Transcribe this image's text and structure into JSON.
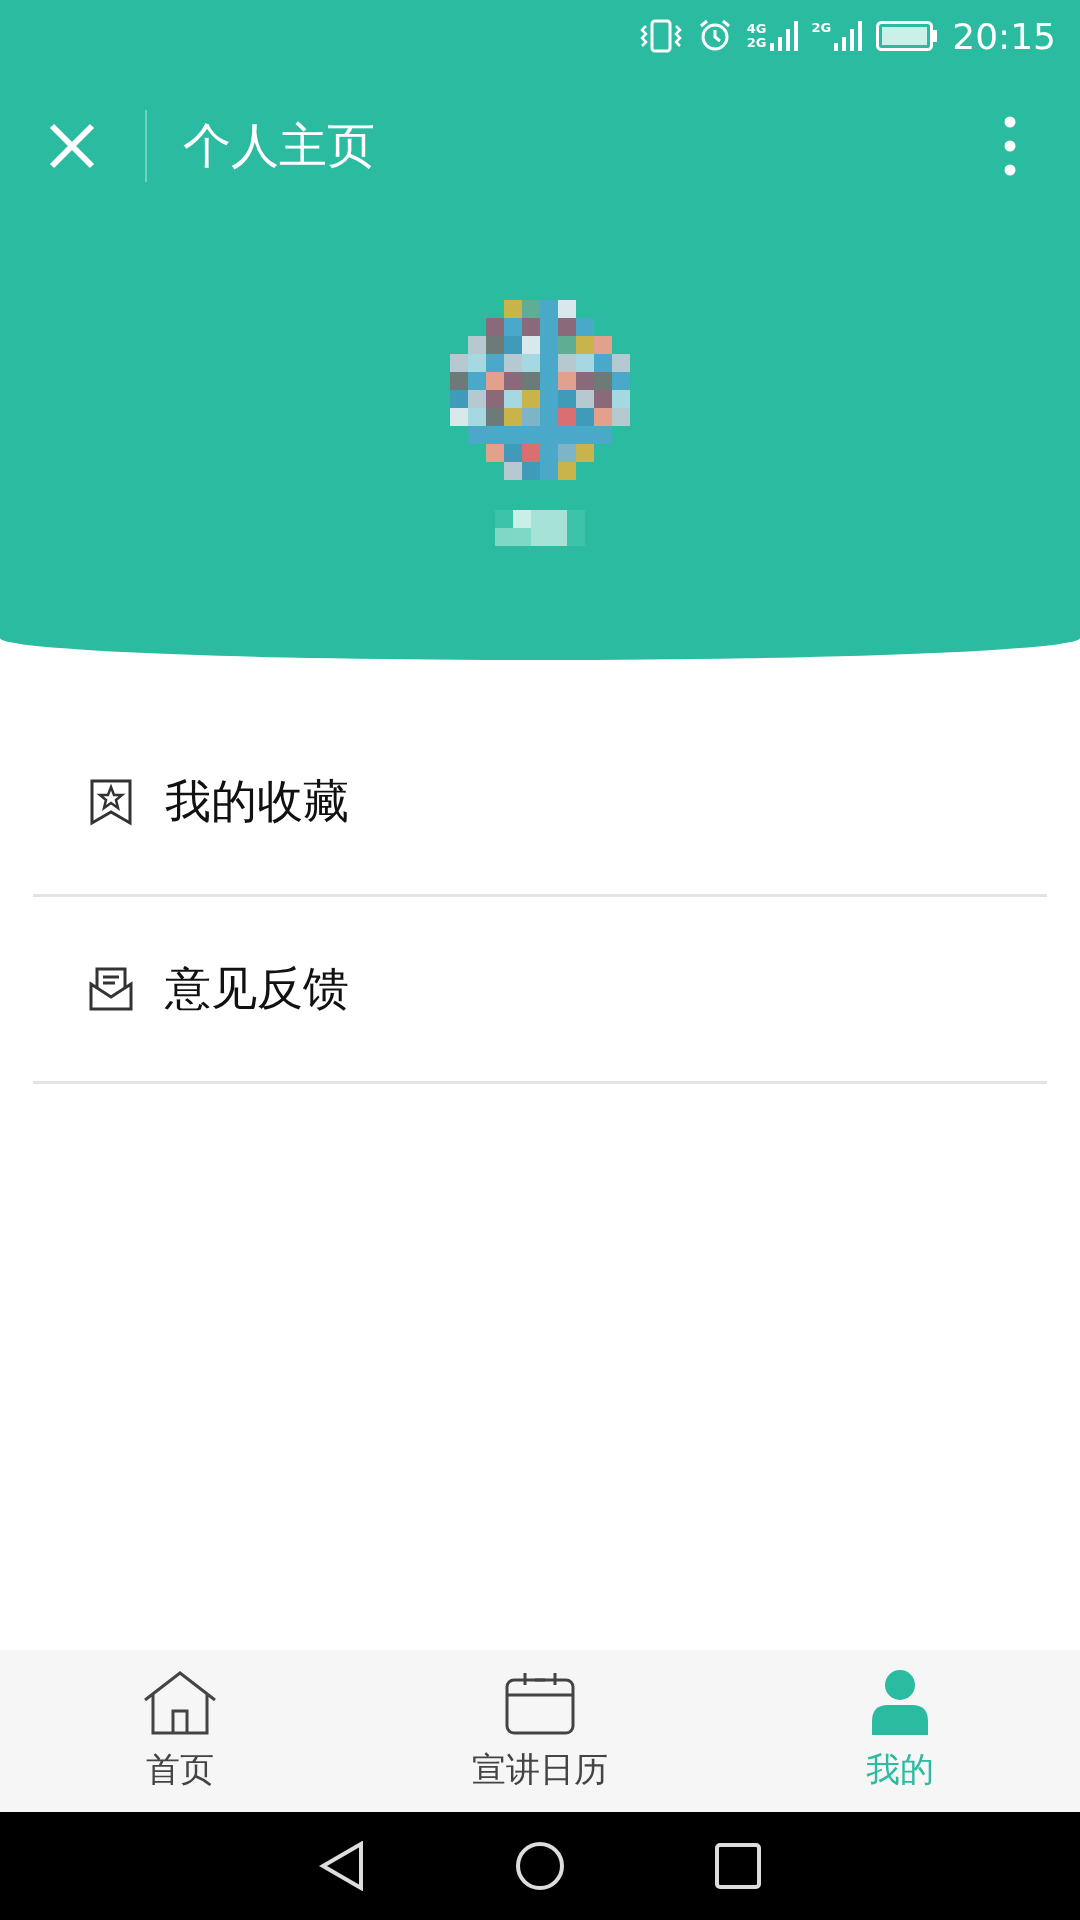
{
  "status_bar": {
    "network_labels": [
      "4G",
      "2G",
      "2G"
    ],
    "time": "20:15"
  },
  "title_bar": {
    "title": "个人主页"
  },
  "menu": [
    {
      "kind": "bookmark",
      "label": "我的收藏"
    },
    {
      "kind": "mail",
      "label": "意见反馈"
    }
  ],
  "tabs": [
    {
      "kind": "home",
      "label": "首页",
      "selected": false
    },
    {
      "kind": "calendar",
      "label": "宣讲日历",
      "selected": false
    },
    {
      "kind": "person",
      "label": "我的",
      "selected": true
    }
  ]
}
